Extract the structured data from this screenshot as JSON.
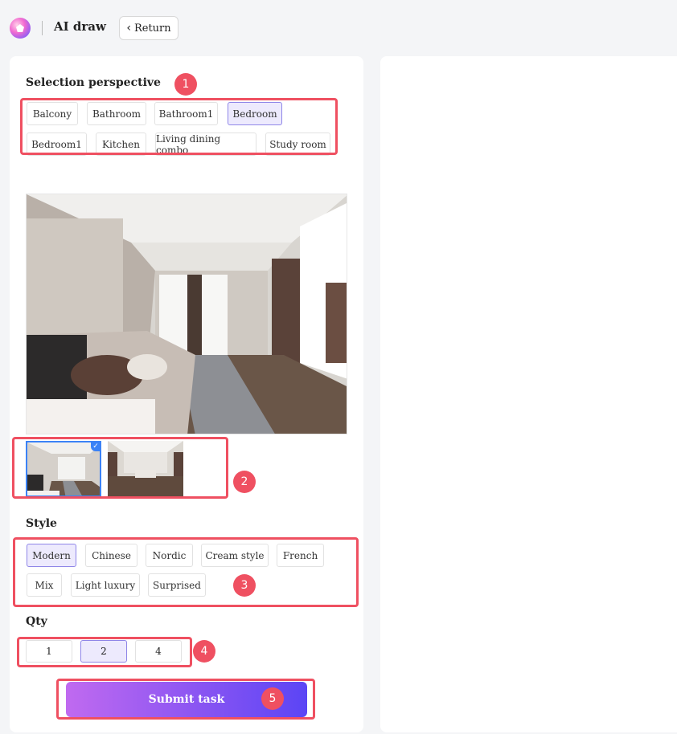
{
  "header": {
    "title": "AI draw",
    "return_label": "Return"
  },
  "perspective": {
    "title": "Selection perspective",
    "options": [
      "Balcony",
      "Bathroom",
      "Bathroom1",
      "Bedroom",
      "Bedroom1",
      "Kitchen",
      "Living dining combo",
      "Study room"
    ],
    "selected": "Bedroom"
  },
  "style": {
    "title": "Style",
    "options": [
      "Modern",
      "Chinese",
      "Nordic",
      "Cream style",
      "French",
      "Mix",
      "Light luxury",
      "Surprised"
    ],
    "selected": "Modern"
  },
  "qty": {
    "title": "Qty",
    "options": [
      "1",
      "2",
      "4"
    ],
    "selected": "2"
  },
  "submit_label": "Submit task",
  "annotations": [
    "1",
    "2",
    "3",
    "4",
    "5"
  ],
  "colors": {
    "accent": "#8a55f2",
    "selected_bg": "#edeafd",
    "annotation": "#ef5061"
  },
  "icons": [
    "logo-icon",
    "chevron-left-icon",
    "check-icon"
  ]
}
